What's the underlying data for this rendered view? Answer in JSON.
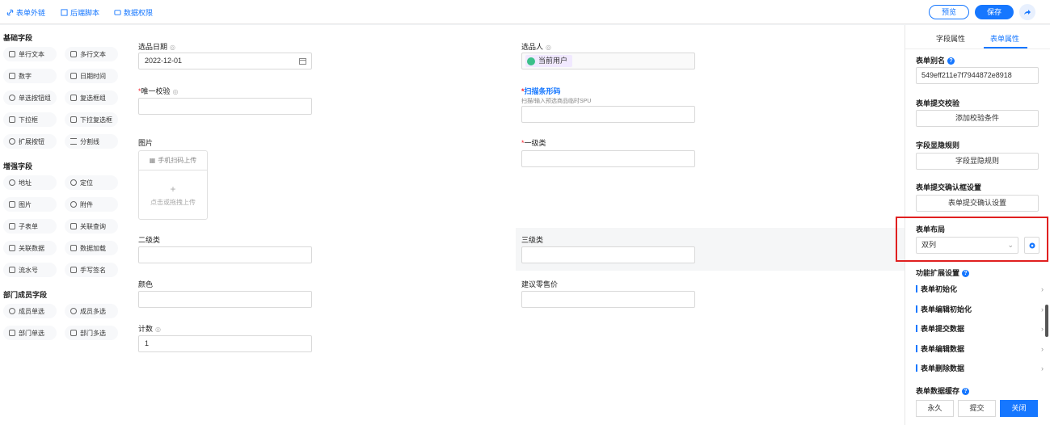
{
  "topbar": {
    "link_external": "表单外链",
    "link_backend_script": "后端脚本",
    "link_data_permission": "数据权限",
    "preview": "预览",
    "save": "保存"
  },
  "left_panel": {
    "basic_title": "基础字段",
    "basic": [
      "单行文本",
      "多行文本",
      "数字",
      "日期时间",
      "单选按钮组",
      "复选框组",
      "下拉框",
      "下拉复选框",
      "扩展按钮",
      "分割线"
    ],
    "enhanced_title": "增强字段",
    "enhanced": [
      "地址",
      "定位",
      "图片",
      "附件",
      "子表单",
      "关联查询",
      "关联数据",
      "数据加载",
      "流水号",
      "手写签名"
    ],
    "dept_title": "部门成员字段",
    "dept": [
      "成员单选",
      "成员多选",
      "部门单选",
      "部门多选"
    ]
  },
  "form": {
    "select_date_label": "选品日期",
    "select_date_value": "2022-12-01",
    "selector_label": "选品人",
    "selector_value": "当前用户",
    "unique_check_label": "唯一校验",
    "scan_label": "扫描条形码",
    "scan_hint": "扫描/输入预选商品临时SPU",
    "image_label": "图片",
    "upload_mobile": "手机扫码上传",
    "upload_click": "点击或拖拽上传",
    "level1_label": "一级类",
    "level2_label": "二级类",
    "level3_label": "三级类",
    "color_label": "颜色",
    "suggested_price_label": "建议零售价",
    "count_label": "计数",
    "count_value": "1"
  },
  "right_panel": {
    "tab_field": "字段属性",
    "tab_form": "表单属性",
    "alias_label": "表单别名",
    "alias_value": "549eff211e7f7944872e8918",
    "submit_check_label": "表单提交校验",
    "add_check": "添加校验条件",
    "visibility_label": "字段显隐规则",
    "visibility_btn": "字段显隐规则",
    "confirm_label": "表单提交确认框设置",
    "confirm_btn": "表单提交确认设置",
    "layout_label": "表单布局",
    "layout_value": "双列",
    "ext_label": "功能扩展设置",
    "ext_items": [
      "表单初始化",
      "表单编辑初始化",
      "表单提交数据",
      "表单编辑数据",
      "表单删除数据"
    ],
    "cache_label": "表单数据缓存",
    "cache_options": [
      "永久",
      "提交",
      "关闭"
    ]
  },
  "colors": {
    "accent": "#1677ff",
    "highlight": "#e02020"
  }
}
